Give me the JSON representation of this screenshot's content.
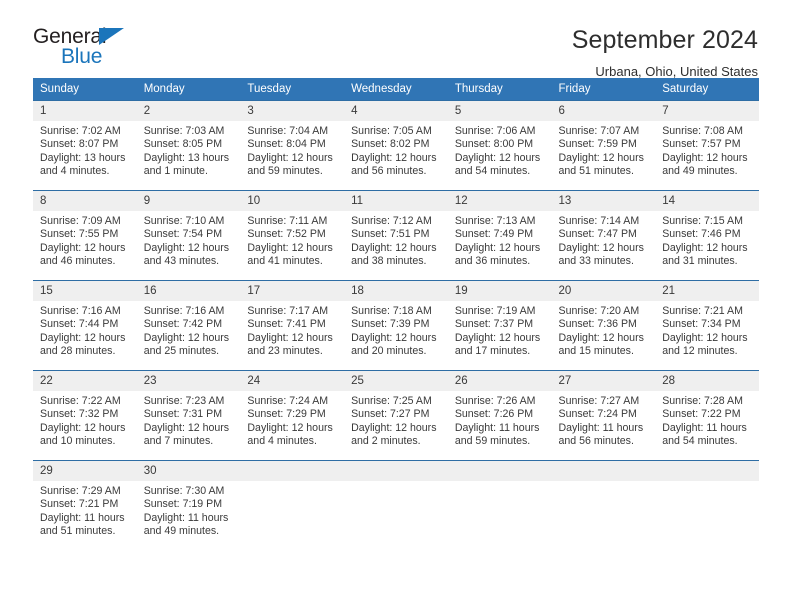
{
  "brand": {
    "name_top": "General",
    "name_bottom": "Blue",
    "accent_color": "#1b75bb"
  },
  "header": {
    "title": "September 2024",
    "subtitle": "Urbana, Ohio, United States"
  },
  "theme": {
    "header_bg": "#3075b5",
    "row_border": "#2e6da4",
    "daynum_bg": "#efefef"
  },
  "weekday_headers": [
    "Sunday",
    "Monday",
    "Tuesday",
    "Wednesday",
    "Thursday",
    "Friday",
    "Saturday"
  ],
  "labels": {
    "sunrise_prefix": "Sunrise:",
    "sunset_prefix": "Sunset:",
    "daylight_prefix": "Daylight:"
  },
  "weeks": [
    [
      {
        "day": "1",
        "sunrise": "Sunrise: 7:02 AM",
        "sunset": "Sunset: 8:07 PM",
        "daylight_line1": "Daylight: 13 hours",
        "daylight_line2": "and 4 minutes."
      },
      {
        "day": "2",
        "sunrise": "Sunrise: 7:03 AM",
        "sunset": "Sunset: 8:05 PM",
        "daylight_line1": "Daylight: 13 hours",
        "daylight_line2": "and 1 minute."
      },
      {
        "day": "3",
        "sunrise": "Sunrise: 7:04 AM",
        "sunset": "Sunset: 8:04 PM",
        "daylight_line1": "Daylight: 12 hours",
        "daylight_line2": "and 59 minutes."
      },
      {
        "day": "4",
        "sunrise": "Sunrise: 7:05 AM",
        "sunset": "Sunset: 8:02 PM",
        "daylight_line1": "Daylight: 12 hours",
        "daylight_line2": "and 56 minutes."
      },
      {
        "day": "5",
        "sunrise": "Sunrise: 7:06 AM",
        "sunset": "Sunset: 8:00 PM",
        "daylight_line1": "Daylight: 12 hours",
        "daylight_line2": "and 54 minutes."
      },
      {
        "day": "6",
        "sunrise": "Sunrise: 7:07 AM",
        "sunset": "Sunset: 7:59 PM",
        "daylight_line1": "Daylight: 12 hours",
        "daylight_line2": "and 51 minutes."
      },
      {
        "day": "7",
        "sunrise": "Sunrise: 7:08 AM",
        "sunset": "Sunset: 7:57 PM",
        "daylight_line1": "Daylight: 12 hours",
        "daylight_line2": "and 49 minutes."
      }
    ],
    [
      {
        "day": "8",
        "sunrise": "Sunrise: 7:09 AM",
        "sunset": "Sunset: 7:55 PM",
        "daylight_line1": "Daylight: 12 hours",
        "daylight_line2": "and 46 minutes."
      },
      {
        "day": "9",
        "sunrise": "Sunrise: 7:10 AM",
        "sunset": "Sunset: 7:54 PM",
        "daylight_line1": "Daylight: 12 hours",
        "daylight_line2": "and 43 minutes."
      },
      {
        "day": "10",
        "sunrise": "Sunrise: 7:11 AM",
        "sunset": "Sunset: 7:52 PM",
        "daylight_line1": "Daylight: 12 hours",
        "daylight_line2": "and 41 minutes."
      },
      {
        "day": "11",
        "sunrise": "Sunrise: 7:12 AM",
        "sunset": "Sunset: 7:51 PM",
        "daylight_line1": "Daylight: 12 hours",
        "daylight_line2": "and 38 minutes."
      },
      {
        "day": "12",
        "sunrise": "Sunrise: 7:13 AM",
        "sunset": "Sunset: 7:49 PM",
        "daylight_line1": "Daylight: 12 hours",
        "daylight_line2": "and 36 minutes."
      },
      {
        "day": "13",
        "sunrise": "Sunrise: 7:14 AM",
        "sunset": "Sunset: 7:47 PM",
        "daylight_line1": "Daylight: 12 hours",
        "daylight_line2": "and 33 minutes."
      },
      {
        "day": "14",
        "sunrise": "Sunrise: 7:15 AM",
        "sunset": "Sunset: 7:46 PM",
        "daylight_line1": "Daylight: 12 hours",
        "daylight_line2": "and 31 minutes."
      }
    ],
    [
      {
        "day": "15",
        "sunrise": "Sunrise: 7:16 AM",
        "sunset": "Sunset: 7:44 PM",
        "daylight_line1": "Daylight: 12 hours",
        "daylight_line2": "and 28 minutes."
      },
      {
        "day": "16",
        "sunrise": "Sunrise: 7:16 AM",
        "sunset": "Sunset: 7:42 PM",
        "daylight_line1": "Daylight: 12 hours",
        "daylight_line2": "and 25 minutes."
      },
      {
        "day": "17",
        "sunrise": "Sunrise: 7:17 AM",
        "sunset": "Sunset: 7:41 PM",
        "daylight_line1": "Daylight: 12 hours",
        "daylight_line2": "and 23 minutes."
      },
      {
        "day": "18",
        "sunrise": "Sunrise: 7:18 AM",
        "sunset": "Sunset: 7:39 PM",
        "daylight_line1": "Daylight: 12 hours",
        "daylight_line2": "and 20 minutes."
      },
      {
        "day": "19",
        "sunrise": "Sunrise: 7:19 AM",
        "sunset": "Sunset: 7:37 PM",
        "daylight_line1": "Daylight: 12 hours",
        "daylight_line2": "and 17 minutes."
      },
      {
        "day": "20",
        "sunrise": "Sunrise: 7:20 AM",
        "sunset": "Sunset: 7:36 PM",
        "daylight_line1": "Daylight: 12 hours",
        "daylight_line2": "and 15 minutes."
      },
      {
        "day": "21",
        "sunrise": "Sunrise: 7:21 AM",
        "sunset": "Sunset: 7:34 PM",
        "daylight_line1": "Daylight: 12 hours",
        "daylight_line2": "and 12 minutes."
      }
    ],
    [
      {
        "day": "22",
        "sunrise": "Sunrise: 7:22 AM",
        "sunset": "Sunset: 7:32 PM",
        "daylight_line1": "Daylight: 12 hours",
        "daylight_line2": "and 10 minutes."
      },
      {
        "day": "23",
        "sunrise": "Sunrise: 7:23 AM",
        "sunset": "Sunset: 7:31 PM",
        "daylight_line1": "Daylight: 12 hours",
        "daylight_line2": "and 7 minutes."
      },
      {
        "day": "24",
        "sunrise": "Sunrise: 7:24 AM",
        "sunset": "Sunset: 7:29 PM",
        "daylight_line1": "Daylight: 12 hours",
        "daylight_line2": "and 4 minutes."
      },
      {
        "day": "25",
        "sunrise": "Sunrise: 7:25 AM",
        "sunset": "Sunset: 7:27 PM",
        "daylight_line1": "Daylight: 12 hours",
        "daylight_line2": "and 2 minutes."
      },
      {
        "day": "26",
        "sunrise": "Sunrise: 7:26 AM",
        "sunset": "Sunset: 7:26 PM",
        "daylight_line1": "Daylight: 11 hours",
        "daylight_line2": "and 59 minutes."
      },
      {
        "day": "27",
        "sunrise": "Sunrise: 7:27 AM",
        "sunset": "Sunset: 7:24 PM",
        "daylight_line1": "Daylight: 11 hours",
        "daylight_line2": "and 56 minutes."
      },
      {
        "day": "28",
        "sunrise": "Sunrise: 7:28 AM",
        "sunset": "Sunset: 7:22 PM",
        "daylight_line1": "Daylight: 11 hours",
        "daylight_line2": "and 54 minutes."
      }
    ],
    [
      {
        "day": "29",
        "sunrise": "Sunrise: 7:29 AM",
        "sunset": "Sunset: 7:21 PM",
        "daylight_line1": "Daylight: 11 hours",
        "daylight_line2": "and 51 minutes."
      },
      {
        "day": "30",
        "sunrise": "Sunrise: 7:30 AM",
        "sunset": "Sunset: 7:19 PM",
        "daylight_line1": "Daylight: 11 hours",
        "daylight_line2": "and 49 minutes."
      },
      {
        "day": "",
        "sunrise": "",
        "sunset": "",
        "daylight_line1": "",
        "daylight_line2": ""
      },
      {
        "day": "",
        "sunrise": "",
        "sunset": "",
        "daylight_line1": "",
        "daylight_line2": ""
      },
      {
        "day": "",
        "sunrise": "",
        "sunset": "",
        "daylight_line1": "",
        "daylight_line2": ""
      },
      {
        "day": "",
        "sunrise": "",
        "sunset": "",
        "daylight_line1": "",
        "daylight_line2": ""
      },
      {
        "day": "",
        "sunrise": "",
        "sunset": "",
        "daylight_line1": "",
        "daylight_line2": ""
      }
    ]
  ]
}
